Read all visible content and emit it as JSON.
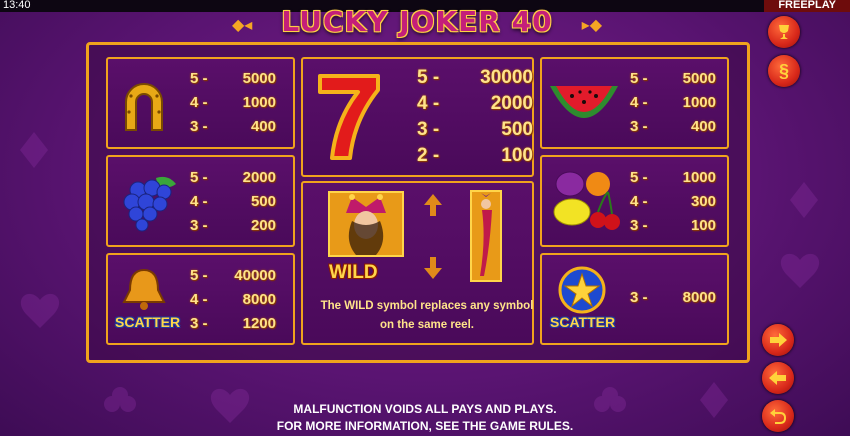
{
  "status_bar": {
    "time": "13:40",
    "mode": "FREEPLAY"
  },
  "title": {
    "text": "LUCKY JOKER 40"
  },
  "symbols": {
    "horseshoe": {
      "icon": "horseshoe-icon",
      "pays": [
        [
          "5 -",
          "5000"
        ],
        [
          "4 -",
          "1000"
        ],
        [
          "3 -",
          "400"
        ]
      ]
    },
    "grapes": {
      "icon": "grapes-icon",
      "pays": [
        [
          "5 -",
          "2000"
        ],
        [
          "4 -",
          "500"
        ],
        [
          "3 -",
          "200"
        ]
      ]
    },
    "bell": {
      "icon": "bell-icon",
      "label": "SCATTER",
      "pays": [
        [
          "5 -",
          "40000"
        ],
        [
          "4 -",
          "8000"
        ],
        [
          "3 -",
          "1200"
        ]
      ]
    },
    "seven": {
      "icon": "seven-icon",
      "pays": [
        [
          "5 -",
          "30000"
        ],
        [
          "4 -",
          "2000"
        ],
        [
          "3 -",
          "500"
        ],
        [
          "2 -",
          "100"
        ]
      ]
    },
    "wild": {
      "icon": "joker-icon",
      "label": "WILD",
      "description": "The WILD symbol replaces any symbol on the same reel."
    },
    "watermelon": {
      "icon": "watermelon-icon",
      "pays": [
        [
          "5 -",
          "5000"
        ],
        [
          "4 -",
          "1000"
        ],
        [
          "3 -",
          "400"
        ]
      ]
    },
    "fruits": {
      "icon": "plum-lemon-cherry-icon",
      "pays": [
        [
          "5 -",
          "1000"
        ],
        [
          "4 -",
          "300"
        ],
        [
          "3 -",
          "100"
        ]
      ]
    },
    "star": {
      "icon": "star-icon",
      "label": "SCATTER",
      "pays": [
        [
          "3 -",
          "8000"
        ]
      ]
    }
  },
  "buttons": {
    "trophy": "trophy-icon",
    "rules": "§",
    "next": "arrow-right-icon",
    "prev": "arrow-left-icon",
    "back": "return-icon"
  },
  "footer": {
    "line1": "MALFUNCTION VOIDS ALL PAYS AND PLAYS.",
    "line2": "FOR MORE INFORMATION, SEE THE GAME RULES."
  },
  "colors": {
    "gold": "#f0a31d",
    "background": "#5a1472",
    "button_red": "#d8281a"
  }
}
